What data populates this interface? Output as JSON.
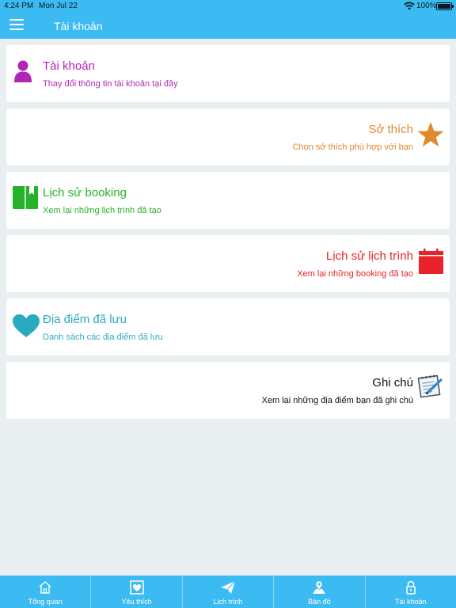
{
  "status": {
    "time": "4:24 PM",
    "date": "Mon Jul 22",
    "battery": "100%"
  },
  "nav": {
    "title": "Tài khoản"
  },
  "cards": [
    {
      "title": "Tài khoản",
      "subtitle": "Thay đổi thông tin tài khoản tại đây",
      "color": "#b126b6",
      "icon": "person-icon"
    },
    {
      "title": "Sở thích",
      "subtitle": "Chọn sở thích phù hợp với bạn",
      "color": "#e08a2c",
      "icon": "star-icon"
    },
    {
      "title": "Lịch sử booking",
      "subtitle": "Xem lại những lịch trình đã tạo",
      "color": "#26b32a",
      "icon": "book-icon"
    },
    {
      "title": "Lịch sử lịch trình",
      "subtitle": "Xem lại những booking đã tạo",
      "color": "#e8242a",
      "icon": "calendar-icon"
    },
    {
      "title": "Địa điểm đã lưu",
      "subtitle": "Danh sách các địa điểm đã lưu",
      "color": "#2aaac2",
      "icon": "heart-icon"
    },
    {
      "title": "Ghi chú",
      "subtitle": "Xem lại những địa điểm bạn đã ghi chú",
      "color": "#111111",
      "icon": "notepad-icon"
    }
  ],
  "tabs": [
    {
      "label": "Tổng quan",
      "icon": "home-icon"
    },
    {
      "label": "Yêu thích",
      "icon": "heart-box-icon"
    },
    {
      "label": "Lịch trình",
      "icon": "paper-plane-icon"
    },
    {
      "label": "Bản đồ",
      "icon": "map-pin-icon"
    },
    {
      "label": "Tài khoản",
      "icon": "lock-icon"
    }
  ]
}
